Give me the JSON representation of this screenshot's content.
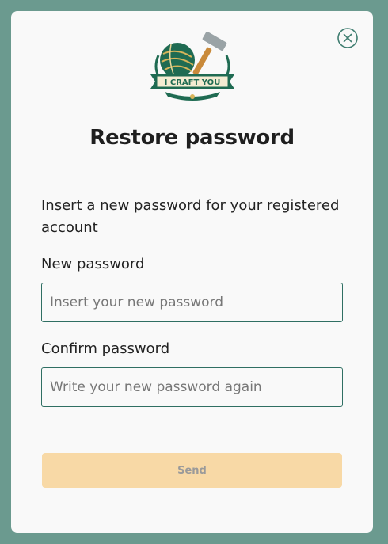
{
  "logo": {
    "banner_text": "I CRAFT YOU",
    "accent_color": "#1f6b52",
    "gold_color": "#d8b55a"
  },
  "modal": {
    "title": "Restore password",
    "description": "Insert a new password for your registered account",
    "close_icon": "close-circle-icon"
  },
  "form": {
    "new_password": {
      "label": "New password",
      "placeholder": "Insert your new password",
      "value": ""
    },
    "confirm_password": {
      "label": "Confirm password",
      "placeholder": "Write your new password again",
      "value": ""
    },
    "send_label": "Send"
  },
  "colors": {
    "backdrop": "#6b9a8f",
    "modal_bg": "#f9f9f9",
    "input_border": "#2f6f63",
    "button_bg": "#f8d9a6",
    "button_text": "#9a9a9a"
  }
}
